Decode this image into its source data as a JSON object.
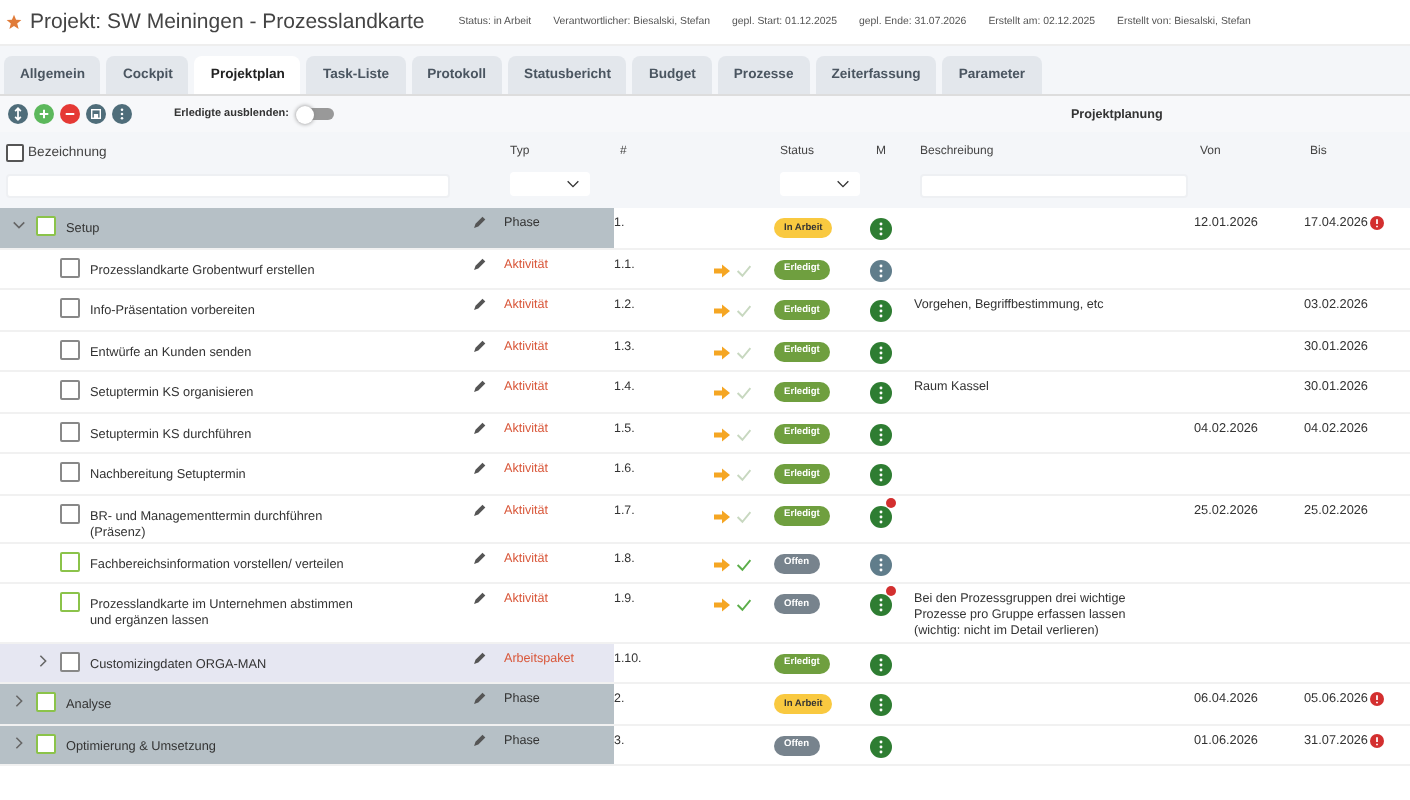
{
  "project": {
    "title": "Projekt: SW Meiningen - Prozesslandkarte",
    "meta": [
      "Status: in Arbeit",
      "Verantwortlicher: Biesalski, Stefan",
      "gepl. Start: 01.12.2025",
      "gepl. Ende: 31.07.2026",
      "Erstellt am: 02.12.2025",
      "Erstellt von: Biesalski, Stefan"
    ]
  },
  "tabs": [
    {
      "label": "Allgemein",
      "selected": false
    },
    {
      "label": "Cockpit",
      "selected": false
    },
    {
      "label": "Projektplan",
      "selected": true
    },
    {
      "label": "Task-Liste",
      "selected": false
    },
    {
      "label": "Protokoll",
      "selected": false
    },
    {
      "label": "Statusbericht",
      "selected": false
    },
    {
      "label": "Budget",
      "selected": false
    },
    {
      "label": "Prozesse",
      "selected": false
    },
    {
      "label": "Zeiterfassung",
      "selected": false
    },
    {
      "label": "Parameter",
      "selected": false
    }
  ],
  "toolbar": {
    "hide_done_label": "Erledigte ausblenden:",
    "hide_done_on": false,
    "title": "Projektplanung"
  },
  "select_all": {
    "checked": false
  },
  "columns": [
    "Bezeichnung",
    "Typ",
    "#",
    "Status",
    "M",
    "Beschreibung",
    "Von",
    "Bis"
  ],
  "rows": [
    {
      "name": "Setup",
      "kind": "phase",
      "type": "Phase",
      "number": "1.",
      "status": {
        "kind": "in_progress",
        "label": "In Arbeit"
      },
      "color": "#2e7d32",
      "from": "12.01.2026",
      "to": "17.04.2026",
      "to_alert": true,
      "expanded": true,
      "children": [
        {
          "name": "Prozesslandkarte Grobentwurf erstellen",
          "kind": "activity",
          "type": "Aktivität",
          "number": "1.1.",
          "status": {
            "kind": "done",
            "label": "Erledigt"
          },
          "color": "#607d8b"
        },
        {
          "name": "Info-Präsentation vorbereiten",
          "kind": "activity",
          "type": "Aktivität",
          "number": "1.2.",
          "status": {
            "kind": "done",
            "label": "Erledigt"
          },
          "color": "#2e7d32",
          "description": "Vorgehen, Begriffbestimmung, etc",
          "to": "03.02.2026"
        },
        {
          "name": "Entwürfe an Kunden senden",
          "kind": "activity",
          "type": "Aktivität",
          "number": "1.3.",
          "status": {
            "kind": "done",
            "label": "Erledigt"
          },
          "color": "#2e7d32",
          "to": "30.01.2026"
        },
        {
          "name": "Setuptermin KS organisieren",
          "kind": "activity",
          "type": "Aktivität",
          "number": "1.4.",
          "status": {
            "kind": "done",
            "label": "Erledigt"
          },
          "color": "#2e7d32",
          "description": "Raum Kassel",
          "to": "30.01.2026"
        },
        {
          "name": "Setuptermin KS durchführen",
          "kind": "activity",
          "type": "Aktivität",
          "number": "1.5.",
          "status": {
            "kind": "done",
            "label": "Erledigt"
          },
          "color": "#2e7d32",
          "from": "04.02.2026",
          "to": "04.02.2026"
        },
        {
          "name": "Nachbereitung Setuptermin",
          "kind": "activity",
          "type": "Aktivität",
          "number": "1.6.",
          "status": {
            "kind": "done",
            "label": "Erledigt"
          },
          "color": "#2e7d32"
        },
        {
          "name": "BR- und Managementtermin durchführen (Präsenz)",
          "kind": "activity",
          "type": "Aktivität",
          "number": "1.7.",
          "status": {
            "kind": "done",
            "label": "Erledigt"
          },
          "color": "#2e7d32",
          "m_badge": true,
          "from": "25.02.2026",
          "to": "25.02.2026"
        },
        {
          "name": "Fachbereichsinformation vorstellen/ verteilen",
          "kind": "activity",
          "type": "Aktivität",
          "number": "1.8.",
          "status": {
            "kind": "open",
            "label": "Offen"
          },
          "color": "#607d8b"
        },
        {
          "name": "Prozesslandkarte im Unternehmen abstimmen und ergänzen lassen",
          "kind": "activity",
          "type": "Aktivität",
          "number": "1.9.",
          "status": {
            "kind": "open",
            "label": "Offen"
          },
          "color": "#2e7d32",
          "m_badge": true,
          "description": "Bei den Prozessgruppen drei wichtige Prozesse pro Gruppe erfassen lassen (wichtig: nicht im Detail verlieren)"
        },
        {
          "name": "Customizingdaten ORGA-MAN",
          "kind": "package",
          "type": "Arbeitspaket",
          "number": "1.10.",
          "status": {
            "kind": "done",
            "label": "Erledigt"
          },
          "color": "#2e7d32",
          "expanded": false
        }
      ]
    },
    {
      "name": "Analyse",
      "kind": "phase",
      "type": "Phase",
      "number": "2.",
      "status": {
        "kind": "in_progress",
        "label": "In Arbeit"
      },
      "color": "#2e7d32",
      "from": "06.04.2026",
      "to": "05.06.2026",
      "to_alert": true,
      "expanded": false
    },
    {
      "name": "Optimierung & Umsetzung",
      "kind": "phase",
      "type": "Phase",
      "number": "3.",
      "status": {
        "kind": "open",
        "label": "Offen"
      },
      "color": "#2e7d32",
      "from": "01.06.2026",
      "to": "31.07.2026",
      "to_alert": true,
      "expanded": false
    }
  ]
}
